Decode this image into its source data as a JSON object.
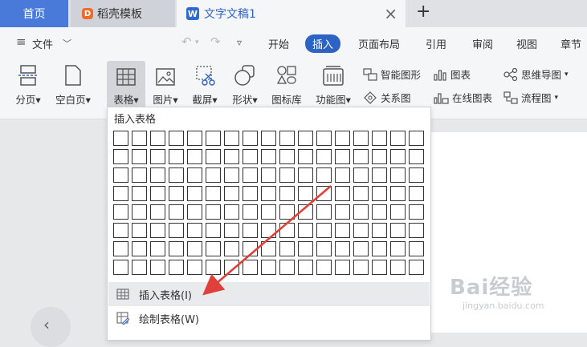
{
  "tabs": {
    "home": "首页",
    "template": "稻壳模板",
    "doc": "文字文稿1",
    "close_glyph": "×",
    "new_glyph": "+"
  },
  "menu": {
    "file": "文件",
    "items": [
      "开始",
      "插入",
      "页面布局",
      "引用",
      "审阅",
      "视图",
      "章节"
    ]
  },
  "ribbon": {
    "page_break": "分页",
    "blank_page": "空白页",
    "table": "表格",
    "picture": "图片",
    "screenshot": "截屏",
    "shape": "形状",
    "icon_lib": "图标库",
    "func_chart": "功能图",
    "smart_art": "智能图形",
    "chart": "图表",
    "mind_map": "思维导图",
    "relation": "关系图",
    "online_chart": "在线图表",
    "flowchart": "流程图"
  },
  "dropdown": {
    "title": "插入表格",
    "insert_table": "插入表格(I)",
    "draw_table": "绘制表格(W)",
    "grid_cols": 17,
    "grid_rows": 8
  },
  "watermark": {
    "brand": "Bai经验",
    "url": "jingyan.baidu.com"
  },
  "colors": {
    "accent": "#2e63c6",
    "home_tab": "#4a7ad9",
    "arrow": "#e0403a"
  }
}
